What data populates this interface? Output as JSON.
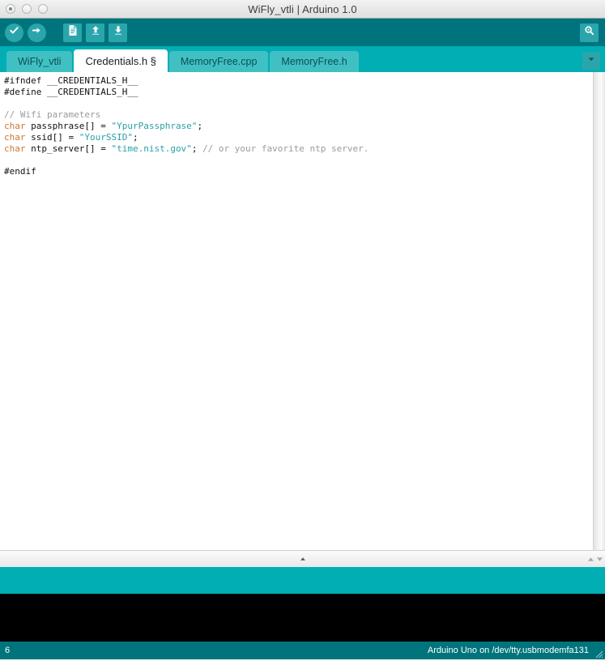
{
  "window": {
    "title": "WiFly_vtli | Arduino 1.0",
    "controls": [
      {
        "name": "close-button",
        "label": ""
      },
      {
        "name": "minimize-button",
        "label": ""
      },
      {
        "name": "zoom-button",
        "label": ""
      }
    ]
  },
  "toolbar": {
    "background": "#00747c",
    "button_bg": "#2aa5ab",
    "buttons": [
      {
        "name": "verify-button",
        "icon": "check-icon",
        "tooltip": "Verify"
      },
      {
        "name": "upload-button",
        "icon": "arrow-right-icon",
        "tooltip": "Upload"
      },
      {
        "name": "new-button",
        "icon": "new-document-icon",
        "tooltip": "New"
      },
      {
        "name": "open-button",
        "icon": "arrow-up-icon",
        "tooltip": "Open"
      },
      {
        "name": "save-button",
        "icon": "arrow-down-icon",
        "tooltip": "Save"
      }
    ],
    "serial_monitor": {
      "name": "serial-monitor-button",
      "icon": "magnifier-icon",
      "tooltip": "Serial Monitor"
    }
  },
  "tabs": {
    "background": "#00aeb4",
    "inactive_bg": "#41c0c4",
    "active_bg": "#ffffff",
    "items": [
      {
        "label": "WiFly_vtli",
        "active": false
      },
      {
        "label": "Credentials.h §",
        "active": true
      },
      {
        "label": "MemoryFree.cpp",
        "active": false
      },
      {
        "label": "MemoryFree.h",
        "active": false
      }
    ],
    "menu_button": {
      "name": "tab-menu-button",
      "icon": "chevron-down-icon"
    }
  },
  "editor": {
    "lines": [
      {
        "tokens": [
          {
            "t": "pre",
            "v": "#ifndef __CREDENTIALS_H__"
          }
        ]
      },
      {
        "tokens": [
          {
            "t": "pre",
            "v": "#define __CREDENTIALS_H__"
          }
        ]
      },
      {
        "tokens": [
          {
            "t": "plain",
            "v": ""
          }
        ]
      },
      {
        "tokens": [
          {
            "t": "cmt",
            "v": "// Wifi parameters"
          }
        ]
      },
      {
        "tokens": [
          {
            "t": "kw",
            "v": "char"
          },
          {
            "t": "plain",
            "v": " passphrase[] = "
          },
          {
            "t": "str",
            "v": "\"YpurPassphrase\""
          },
          {
            "t": "plain",
            "v": ";"
          }
        ]
      },
      {
        "tokens": [
          {
            "t": "kw",
            "v": "char"
          },
          {
            "t": "plain",
            "v": " ssid[] = "
          },
          {
            "t": "str",
            "v": "\"YourSSID\""
          },
          {
            "t": "plain",
            "v": ";"
          }
        ]
      },
      {
        "tokens": [
          {
            "t": "kw",
            "v": "char"
          },
          {
            "t": "plain",
            "v": " ntp_server[] = "
          },
          {
            "t": "str",
            "v": "\"time.nist.gov\""
          },
          {
            "t": "plain",
            "v": "; "
          },
          {
            "t": "cmt",
            "v": "// or your favorite ntp server."
          }
        ]
      },
      {
        "tokens": [
          {
            "t": "plain",
            "v": ""
          }
        ]
      },
      {
        "tokens": [
          {
            "t": "pre",
            "v": "#endif"
          }
        ]
      }
    ],
    "colors": {
      "preprocessor": "#111111",
      "keyword": "#cc7832",
      "string": "#2a9fa8",
      "comment": "#9b9b9b",
      "background": "#ffffff"
    }
  },
  "message_bar": {
    "text": "",
    "background": "#00aeb4"
  },
  "console": {
    "text": "",
    "background": "#000000"
  },
  "statusbar": {
    "line_number": "6",
    "board_info": "Arduino Uno on /dev/tty.usbmodemfa131",
    "background": "#00747c"
  }
}
